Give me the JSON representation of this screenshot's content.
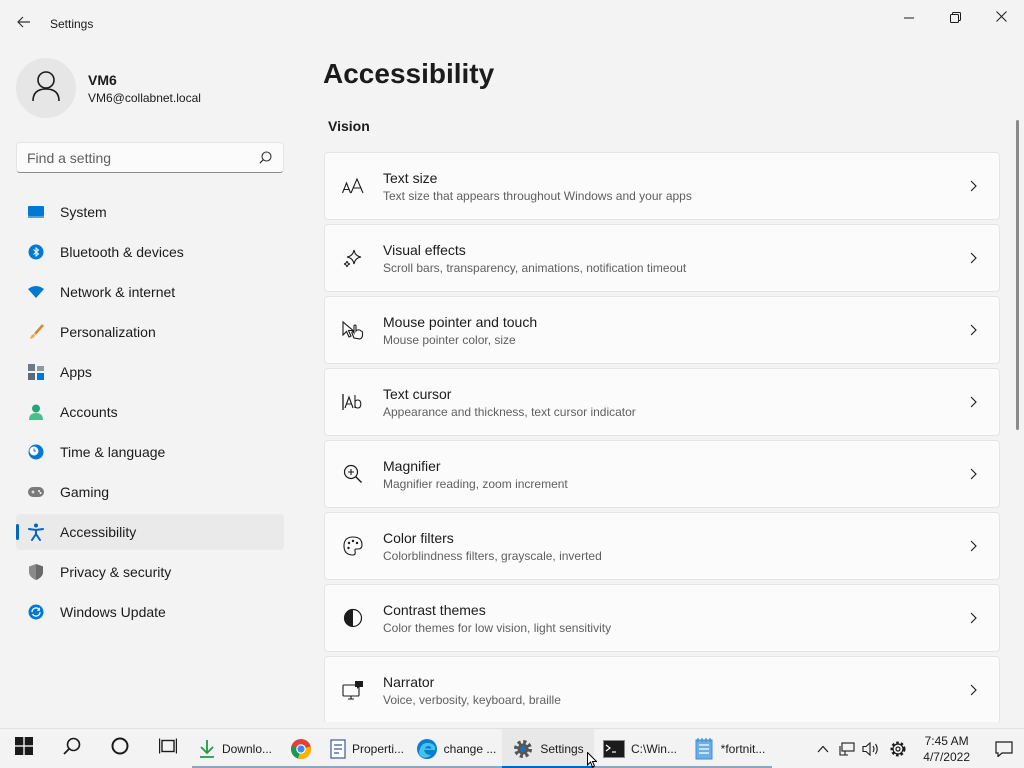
{
  "window": {
    "title": "Settings",
    "back_icon": "back-arrow-icon",
    "minimize_icon": "minimize-icon",
    "maximize_icon": "maximize-icon",
    "close_icon": "close-icon"
  },
  "profile": {
    "name": "VM6",
    "email": "VM6@collabnet.local",
    "avatar_icon": "user-icon"
  },
  "search": {
    "placeholder": "Find a setting",
    "value": "",
    "icon": "search-icon"
  },
  "sidebar": {
    "items": [
      {
        "label": "System",
        "icon": "system-icon",
        "color": "#0078d4"
      },
      {
        "label": "Bluetooth & devices",
        "icon": "bluetooth-icon",
        "color": "#0078d4"
      },
      {
        "label": "Network & internet",
        "icon": "wifi-icon",
        "color": "#0078d4"
      },
      {
        "label": "Personalization",
        "icon": "brush-icon",
        "color": "#d08a2e"
      },
      {
        "label": "Apps",
        "icon": "apps-icon",
        "color": "#5b6b7a"
      },
      {
        "label": "Accounts",
        "icon": "accounts-icon",
        "color": "#27a37a"
      },
      {
        "label": "Time & language",
        "icon": "clock-globe-icon",
        "color": "#0078d4"
      },
      {
        "label": "Gaming",
        "icon": "gamepad-icon",
        "color": "#7a7a7a"
      },
      {
        "label": "Accessibility",
        "icon": "accessibility-icon",
        "color": "#0067c0",
        "active": true
      },
      {
        "label": "Privacy & security",
        "icon": "shield-icon",
        "color": "#7a7a7a"
      },
      {
        "label": "Windows Update",
        "icon": "update-icon",
        "color": "#0078d4"
      }
    ]
  },
  "main": {
    "page_title": "Accessibility",
    "section_title": "Vision",
    "cards": [
      {
        "title": "Text size",
        "desc": "Text size that appears throughout Windows and your apps",
        "icon": "text-size-icon"
      },
      {
        "title": "Visual effects",
        "desc": "Scroll bars, transparency, animations, notification timeout",
        "icon": "sparkle-icon"
      },
      {
        "title": "Mouse pointer and touch",
        "desc": "Mouse pointer color, size",
        "icon": "pointer-touch-icon"
      },
      {
        "title": "Text cursor",
        "desc": "Appearance and thickness, text cursor indicator",
        "icon": "text-cursor-icon"
      },
      {
        "title": "Magnifier",
        "desc": "Magnifier reading, zoom increment",
        "icon": "magnifier-icon"
      },
      {
        "title": "Color filters",
        "desc": "Colorblindness filters, grayscale, inverted",
        "icon": "palette-icon"
      },
      {
        "title": "Contrast themes",
        "desc": "Color themes for low vision, light sensitivity",
        "icon": "contrast-icon"
      },
      {
        "title": "Narrator",
        "desc": "Voice, verbosity, keyboard, braille",
        "icon": "narrator-icon"
      }
    ]
  },
  "taskbar": {
    "start_icon": "windows-start-icon",
    "search_icon": "search-icon",
    "cortana_icon": "cortana-circle-icon",
    "taskview_icon": "task-view-icon",
    "apps": [
      {
        "label": "Downlo...",
        "icon": "download-icon",
        "color": "#1a9e4a"
      },
      {
        "label": "",
        "icon": "chrome-icon",
        "color": "#db4437"
      },
      {
        "label": "Properti...",
        "icon": "properties-icon",
        "color": "#3b5998"
      },
      {
        "label": "change ...",
        "icon": "edge-icon",
        "color": "#0c7bd6"
      },
      {
        "label": "Settings",
        "icon": "gear-icon",
        "color": "#555555",
        "active": true
      },
      {
        "label": "C:\\Win...",
        "icon": "terminal-icon",
        "color": "#1b1b1b"
      },
      {
        "label": "*fortnit...",
        "icon": "notepad-icon",
        "color": "#3a8fd6"
      }
    ],
    "tray": {
      "icons": [
        "chevron-up-icon",
        "network-icon",
        "volume-icon",
        "gear-icon"
      ],
      "time": "7:45 AM",
      "date": "4/7/2022",
      "notification_icon": "notification-icon"
    }
  },
  "colors": {
    "accent": "#0067c0",
    "background": "#f3f3f3",
    "card": "#fbfbfb"
  }
}
